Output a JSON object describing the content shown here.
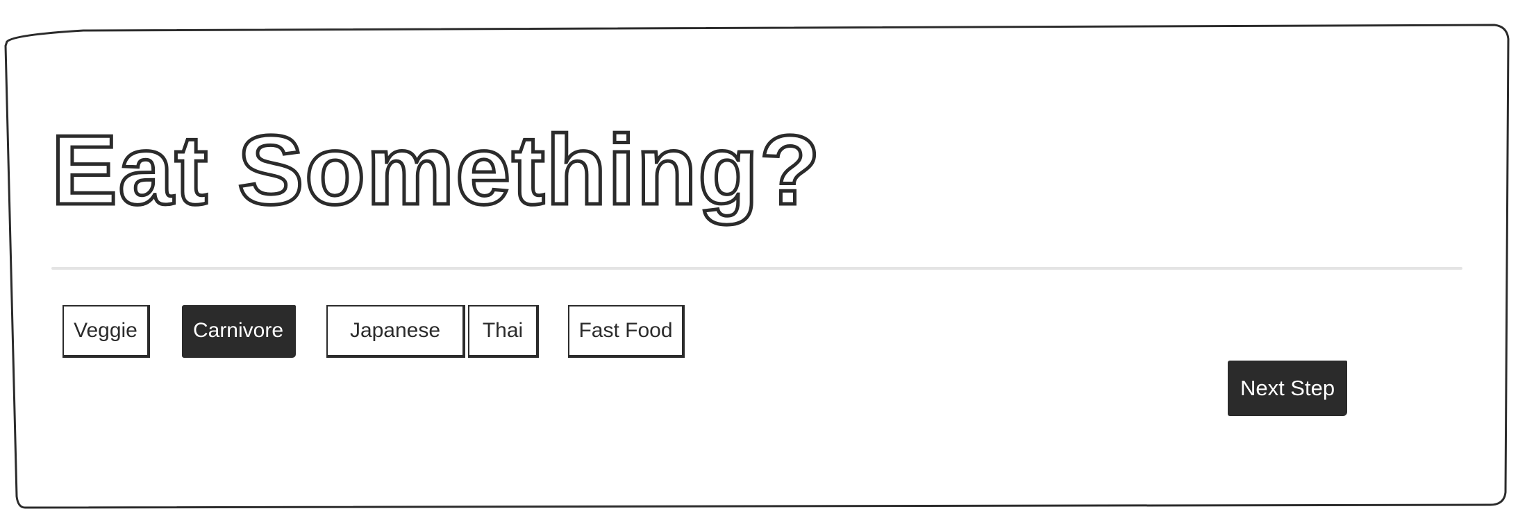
{
  "page": {
    "title": "Eat Something?"
  },
  "options": [
    {
      "label": "Veggie",
      "selected": false
    },
    {
      "label": "Carnivore",
      "selected": true
    },
    {
      "label": "Japanese",
      "selected": false
    },
    {
      "label": "Thai",
      "selected": false
    },
    {
      "label": "Fast Food",
      "selected": false
    }
  ],
  "actions": {
    "next_label": "Next Step"
  },
  "colors": {
    "ink": "#2b2b2b",
    "background": "#ffffff",
    "divider": "#e4e4e4"
  }
}
